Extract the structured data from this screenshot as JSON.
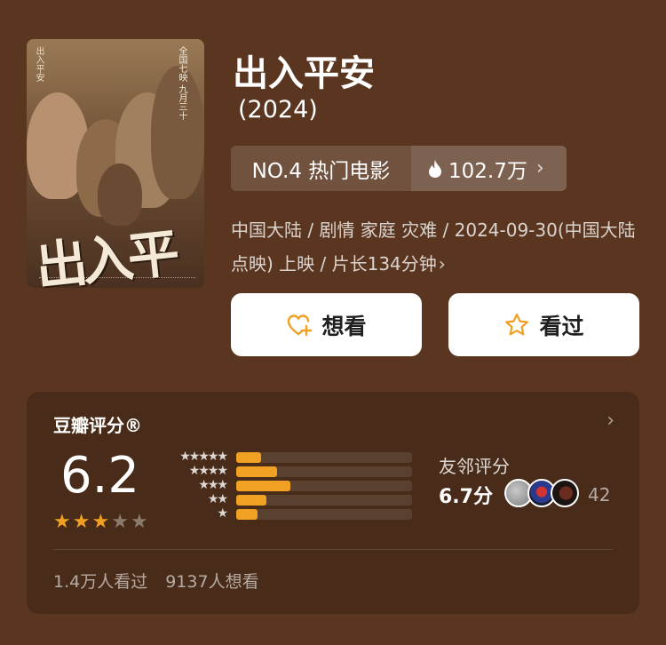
{
  "movie": {
    "title": "出入平安",
    "year": "(2024)",
    "rank_label": "NO.4 热门电影",
    "heat_count": "102.7万",
    "meta_line": "中国大陆 / 剧情 家庭 灾难 / 2024-09-30(中国大陆点映) 上映 / 片长134分钟",
    "poster": {
      "title_art": "出入平安",
      "tagline": "全国七映 九月三十",
      "side_text": "出入平安"
    }
  },
  "actions": {
    "want_label": "想看",
    "seen_label": "看过"
  },
  "rating": {
    "section_title": "豆瓣评分®",
    "score": "6.2",
    "star_count": 3,
    "distribution": [
      {
        "stars": 5,
        "label": "★★★★★",
        "fraction": 0.14
      },
      {
        "stars": 4,
        "label": "★★★★",
        "fraction": 0.23
      },
      {
        "stars": 3,
        "label": "★★★",
        "fraction": 0.31
      },
      {
        "stars": 2,
        "label": "★★",
        "fraction": 0.17
      },
      {
        "stars": 1,
        "label": "★",
        "fraction": 0.12
      }
    ],
    "friends_label": "友邻评分",
    "friends_score": "6.7分",
    "friends_count": "42"
  },
  "stats": {
    "seen": "1.4万人看过",
    "want": "9137人想看"
  },
  "colors": {
    "background": "#5a3620",
    "star_active": "#f0a022",
    "star_inactive": "#8a7a6a",
    "want_icon": "#f0a022",
    "seen_icon": "#f0a022"
  }
}
